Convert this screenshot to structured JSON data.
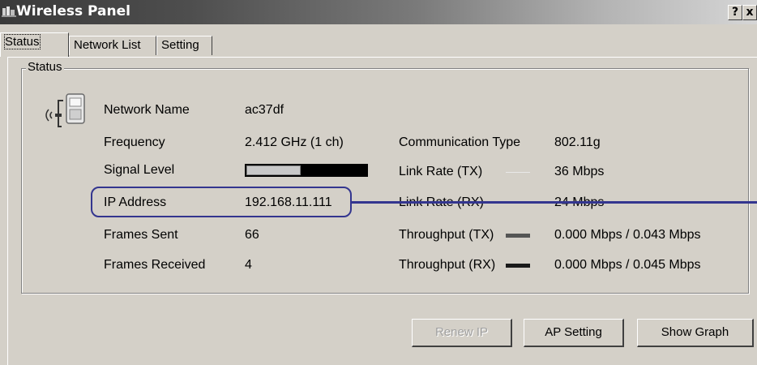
{
  "window": {
    "title": "Wireless Panel",
    "help_button": "?",
    "close_button": "x"
  },
  "tabs": [
    {
      "label": "Status",
      "active": true
    },
    {
      "label": "Network List",
      "active": false
    },
    {
      "label": "Setting",
      "active": false
    }
  ],
  "status_group": {
    "legend": "Status",
    "network_name": {
      "label": "Network Name",
      "value": "ac37df"
    },
    "frequency": {
      "label": "Frequency",
      "value": "2.412 GHz (1 ch)"
    },
    "signal_level": {
      "label": "Signal Level",
      "fraction": 0.45
    },
    "ip_address": {
      "label": "IP Address",
      "value": "192.168.11.111"
    },
    "frames_sent": {
      "label": "Frames Sent",
      "value": "66"
    },
    "frames_received": {
      "label": "Frames Received",
      "value": "4"
    },
    "communication_type": {
      "label": "Communication Type",
      "value": "802.11g"
    },
    "link_rate_tx": {
      "label": "Link Rate (TX)",
      "value": "36 Mbps"
    },
    "link_rate_rx": {
      "label": "Link Rate (RX)",
      "value": "24 Mbps"
    },
    "throughput_tx": {
      "label": "Throughput (TX)",
      "value": "0.000 Mbps / 0.043 Mbps"
    },
    "throughput_rx": {
      "label": "Throughput (RX)",
      "value": "0.000 Mbps / 0.045 Mbps"
    }
  },
  "buttons": {
    "renew_ip": "Renew IP",
    "ap_setting": "AP Setting",
    "show_graph": "Show Graph"
  },
  "colors": {
    "highlight": "#33358f",
    "face": "#d4d0c8"
  }
}
